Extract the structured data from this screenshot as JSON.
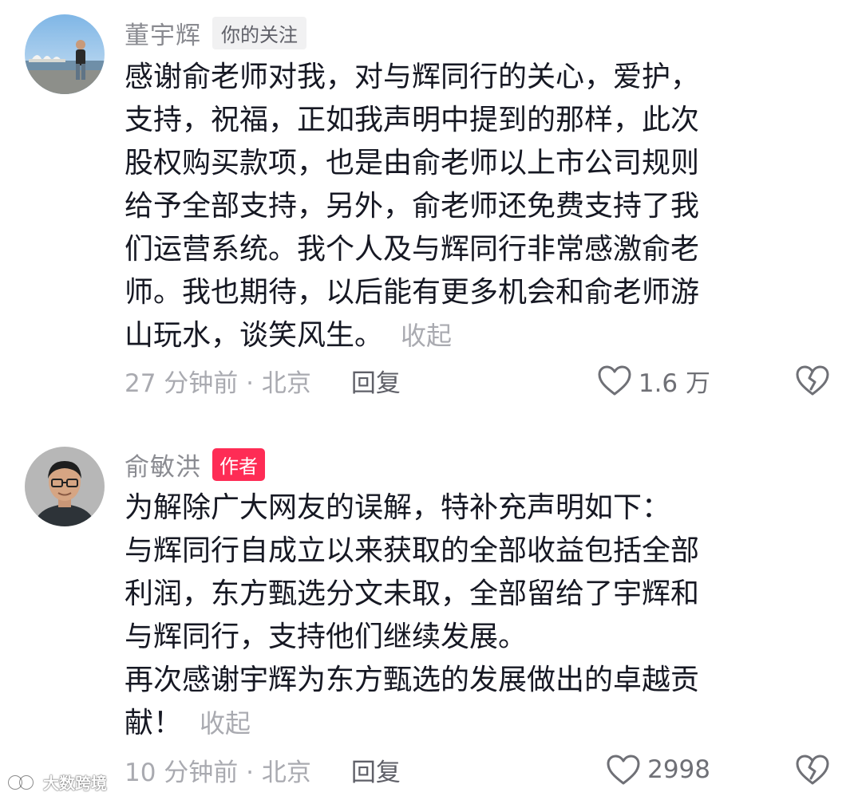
{
  "comments": [
    {
      "username": "董宇辉",
      "badge": "你的关注",
      "avatar_icon": "profile-photo-opera-house",
      "lines": [
        "感谢俞老师对我，对与辉同行的关心，爱护，",
        "支持，祝福，正如我声明中提到的那样，此次",
        "股权购买款项，也是由俞老师以上市公司规则",
        "给予全部支持，另外，俞老师还免费支持了我",
        "们运营系统。我个人及与辉同行非常感激俞老",
        "师。我也期待，以后能有更多机会和俞老师游",
        "山玩水，谈笑风生。"
      ],
      "collapse_label": "收起",
      "meta": "27 分钟前 · 北京",
      "reply_label": "回复",
      "like_count": "1.6 万"
    },
    {
      "username": "俞敏洪",
      "badge": "作者",
      "avatar_icon": "profile-photo-man-glasses",
      "lines": [
        "为解除广大网友的误解，特补充声明如下：",
        "与辉同行自成立以来获取的全部收益包括全部",
        "利润，东方甄选分文未取，全部留给了宇辉和",
        "与辉同行，支持他们继续发展。",
        "再次感谢宇辉为东方甄选的发展做出的卓越贡",
        "献！"
      ],
      "collapse_label": "收起",
      "meta": "10 分钟前 · 北京",
      "reply_label": "回复",
      "like_count": "2998"
    }
  ],
  "watermark": {
    "text": "大数跨境",
    "icon": "dashuju-logo-icon"
  },
  "colors": {
    "author_badge": "#fe2c55",
    "username": "#8a8b91",
    "muted": "#a9aab0",
    "text": "#161823"
  }
}
